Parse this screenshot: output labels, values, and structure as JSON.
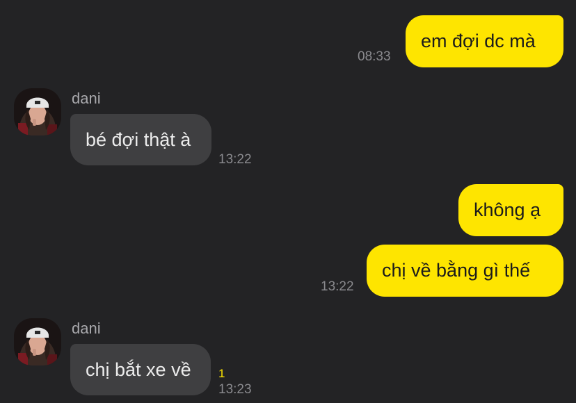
{
  "conversation": {
    "messages": [
      {
        "direction": "outgoing",
        "text": "em đợi dc mà",
        "time": "08:33"
      },
      {
        "direction": "incoming",
        "sender": "dani",
        "text": "bé đợi thật à",
        "time": "13:22"
      },
      {
        "direction": "outgoing",
        "text": "không ạ"
      },
      {
        "direction": "outgoing",
        "text": "chị về bằng gì thế",
        "time": "13:22"
      },
      {
        "direction": "incoming",
        "sender": "dani",
        "text": "chị bắt xe về",
        "time": "13:23",
        "unread_count": "1"
      }
    ]
  },
  "colors": {
    "background": "#232325",
    "outgoing_bubble": "#fee500",
    "incoming_bubble": "#3f3f41",
    "unread_count": "#fee500"
  },
  "icons": {
    "avatar": "profile-photo"
  }
}
